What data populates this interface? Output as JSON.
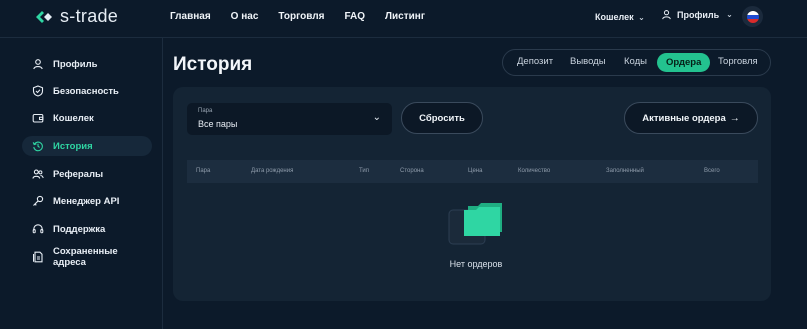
{
  "header": {
    "logo_text": "s-trade",
    "nav": [
      "Главная",
      "О нас",
      "Торговля",
      "FAQ",
      "Листинг"
    ],
    "wallet_label": "Кошелек",
    "profile_label": "Профиль"
  },
  "sidebar": {
    "items": [
      {
        "label": "Профиль",
        "icon": "user-icon",
        "active": false
      },
      {
        "label": "Безопасность",
        "icon": "shield-icon",
        "active": false
      },
      {
        "label": "Кошелек",
        "icon": "wallet-icon",
        "active": false
      },
      {
        "label": "История",
        "icon": "history-icon",
        "active": true
      },
      {
        "label": "Рефералы",
        "icon": "users-icon",
        "active": false
      },
      {
        "label": "Менеджер API",
        "icon": "key-icon",
        "active": false
      },
      {
        "label": "Поддержка",
        "icon": "headset-icon",
        "active": false
      },
      {
        "label": "Сохраненные адреса",
        "icon": "address-icon",
        "active": false
      }
    ]
  },
  "main": {
    "title": "История",
    "tabs": [
      "Депозит",
      "Выводы",
      "Коды",
      "Ордера",
      "Торговля"
    ],
    "active_tab": "Ордера",
    "filter": {
      "pair_label": "Пара",
      "pair_value": "Все пары",
      "reset_label": "Сбросить",
      "active_orders_label": "Активные ордера"
    },
    "table": {
      "columns": [
        "Пара",
        "Дата рождения",
        "Тип",
        "Сторона",
        "Цена",
        "Количество",
        "Заполненный",
        "Всего"
      ]
    },
    "empty_text": "Нет ордеров"
  },
  "colors": {
    "accent": "#23c28f",
    "background": "#0c1a2a",
    "panel": "#142434"
  }
}
